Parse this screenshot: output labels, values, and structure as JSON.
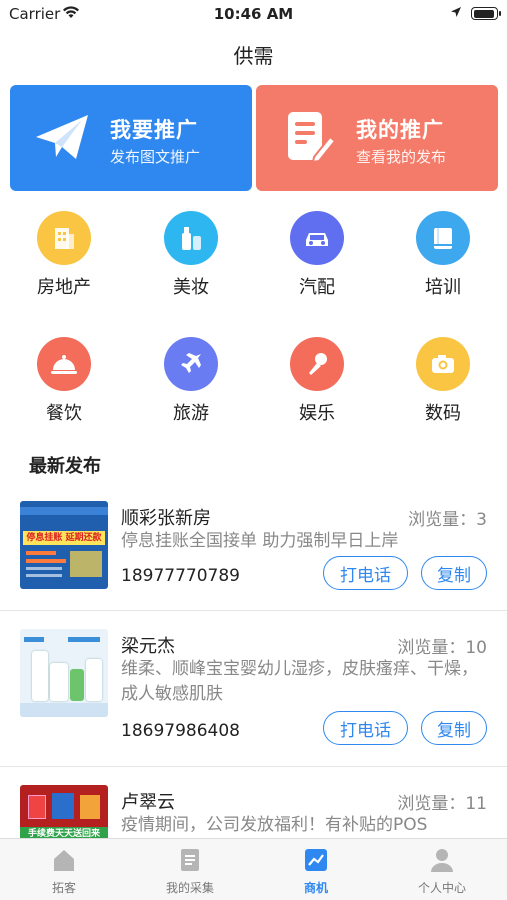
{
  "status_bar": {
    "carrier": "Carrier",
    "time": "10:46 AM"
  },
  "nav": {
    "title": "供需"
  },
  "banners": [
    {
      "title": "我要推广",
      "subtitle": "发布图文推广",
      "icon": "paper-plane-icon",
      "color": "#2f88f0"
    },
    {
      "title": "我的推广",
      "subtitle": "查看我的发布",
      "icon": "document-edit-icon",
      "color": "#f47b69"
    }
  ],
  "categories": [
    {
      "label": "房地产",
      "icon": "building-icon",
      "color": "#f9c543"
    },
    {
      "label": "美妆",
      "icon": "cosmetics-icon",
      "color": "#2eb6f0"
    },
    {
      "label": "汽配",
      "icon": "car-icon",
      "color": "#5f6ff0"
    },
    {
      "label": "培训",
      "icon": "book-icon",
      "color": "#3ea8ee"
    },
    {
      "label": "餐饮",
      "icon": "food-cloche-icon",
      "color": "#f46d5b"
    },
    {
      "label": "旅游",
      "icon": "airplane-icon",
      "color": "#6a7cf2"
    },
    {
      "label": "娱乐",
      "icon": "microphone-icon",
      "color": "#f46d5b"
    },
    {
      "label": "数码",
      "icon": "camera-icon",
      "color": "#f9c543"
    }
  ],
  "section": {
    "title": "最新发布"
  },
  "posts": [
    {
      "name": "顺彩张新房",
      "views_label": "浏览量：3",
      "description": "停息挂账全国接单 助力强制早日上岸",
      "phone": "18977770789",
      "call_label": "打电话",
      "copy_label": "复制",
      "thumb_text": "停息挂账 延期还款"
    },
    {
      "name": "梁元杰",
      "views_label": "浏览量：10",
      "description": "维柔、顺峰宝宝婴幼儿湿疹，皮肤瘙痒、干燥，成人敏感肌肤",
      "phone": "18697986408",
      "call_label": "打电话",
      "copy_label": "复制"
    },
    {
      "name": "卢翠云",
      "views_label": "浏览量：11",
      "description": "疫情期间，公司发放福利！有补贴的POS",
      "thumb_text": "手续费天天送回来"
    }
  ],
  "tabbar": [
    {
      "label": "拓客",
      "icon": "home-icon",
      "active": false
    },
    {
      "label": "我的采集",
      "icon": "list-icon",
      "active": false
    },
    {
      "label": "商机",
      "icon": "chart-icon",
      "active": true
    },
    {
      "label": "个人中心",
      "icon": "person-icon",
      "active": false
    }
  ]
}
